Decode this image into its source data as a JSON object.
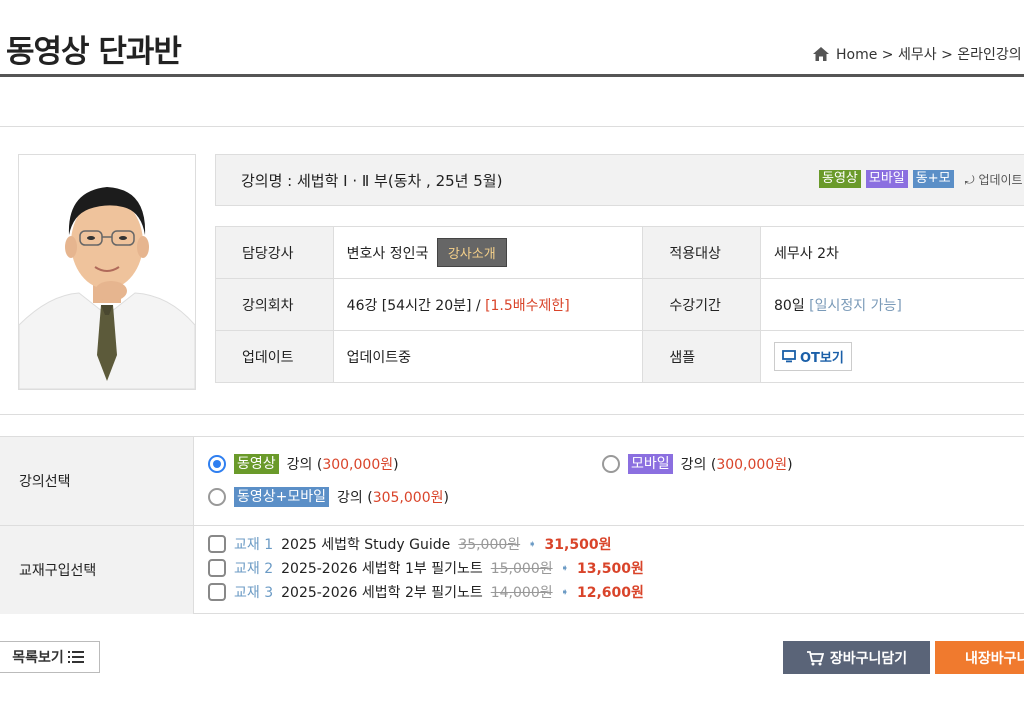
{
  "header": {
    "page_title": "동영상 단과반",
    "breadcrumb": "Home > 세무사 > 온라인강의"
  },
  "course": {
    "name": "강의명 : 세법학 Ⅰ · Ⅱ 부(동차 , 25년 5월)",
    "badges": [
      {
        "label": "동영상",
        "color": "#6a9a2a"
      },
      {
        "label": "모바일",
        "color": "#8b6fe0"
      },
      {
        "label": "동+모",
        "color": "#5b8fc7"
      }
    ],
    "update_link": "업데이트"
  },
  "info": {
    "instructor_label": "담당강사",
    "instructor_value": "변호사 정인국",
    "instructor_button": "강사소개",
    "target_label": "적용대상",
    "target_value": "세무사 2차",
    "sessions_label": "강의회차",
    "sessions_value": "46강 [54시간 20분] / ",
    "sessions_limit": "[1.5배수제한]",
    "period_label": "수강기간",
    "period_value": "80일 ",
    "period_note": "[일시정지 가능]",
    "update_label": "업데이트",
    "update_value": "업데이트중",
    "sample_label": "샘플",
    "sample_button": "OT보기"
  },
  "options": {
    "select_label": "강의선택",
    "choices": [
      {
        "tag": "동영상",
        "tag_color": "#6a9a2a",
        "text": "강의 (",
        "price": "300,000원",
        "close": ")",
        "selected": true
      },
      {
        "tag": "모바일",
        "tag_color": "#8b6fe0",
        "text": "강의 (",
        "price": "300,000원",
        "close": ")",
        "selected": false
      },
      {
        "tag": "동영상+모바일",
        "tag_color": "#5b8fc7",
        "text": "강의 (",
        "price": "305,000원",
        "close": ")",
        "selected": false
      }
    ],
    "book_label": "교재구입선택",
    "books": [
      {
        "no": "교재 1",
        "title": "2025 세법학 Study Guide",
        "orig": "35,000원",
        "sale": "31,500원"
      },
      {
        "no": "교재 2",
        "title": "2025-2026 세법학 1부 필기노트",
        "orig": "15,000원",
        "sale": "13,500원"
      },
      {
        "no": "교재 3",
        "title": "2025-2026 세법학 2부 필기노트",
        "orig": "14,000원",
        "sale": "12,600원"
      }
    ]
  },
  "buttons": {
    "list": "목록보기",
    "cart": "장바구니담기",
    "my": "내장바구니"
  }
}
